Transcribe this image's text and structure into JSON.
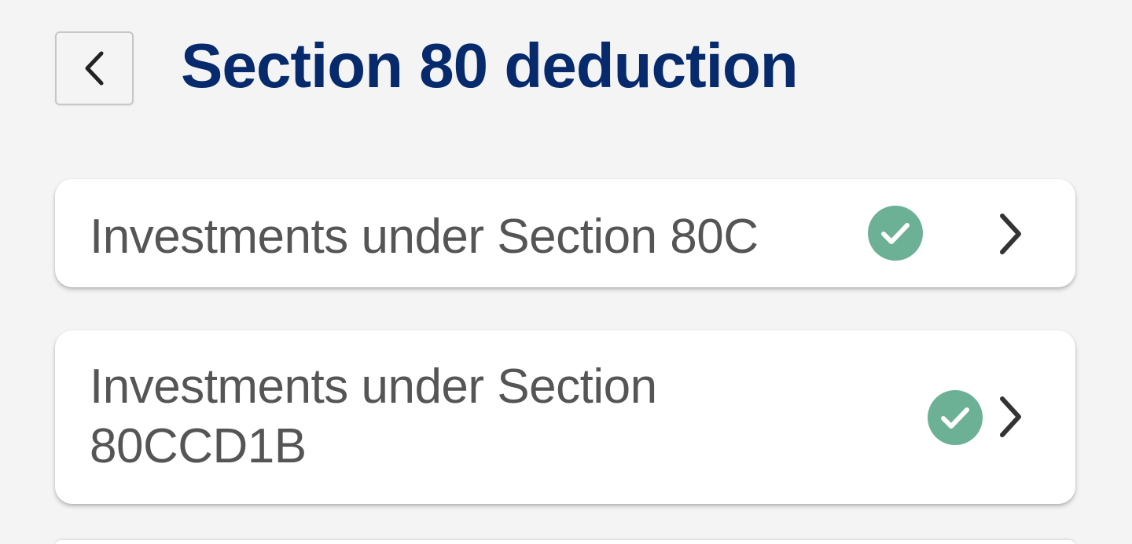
{
  "header": {
    "title": "Section 80 deduction",
    "back_icon": "chevron-left-icon"
  },
  "items": [
    {
      "label": "Investments under Section 80C",
      "status": "completed",
      "status_icon": "check-circle-icon",
      "nav_icon": "chevron-right-icon"
    },
    {
      "label": "Investments under Section 80CCD1B",
      "status": "completed",
      "status_icon": "check-circle-icon",
      "nav_icon": "chevron-right-icon"
    }
  ],
  "colors": {
    "background": "#f4f4f5",
    "title": "#062a6b",
    "label": "#555555",
    "check_badge": "#6cb095",
    "chevron": "#333333"
  }
}
